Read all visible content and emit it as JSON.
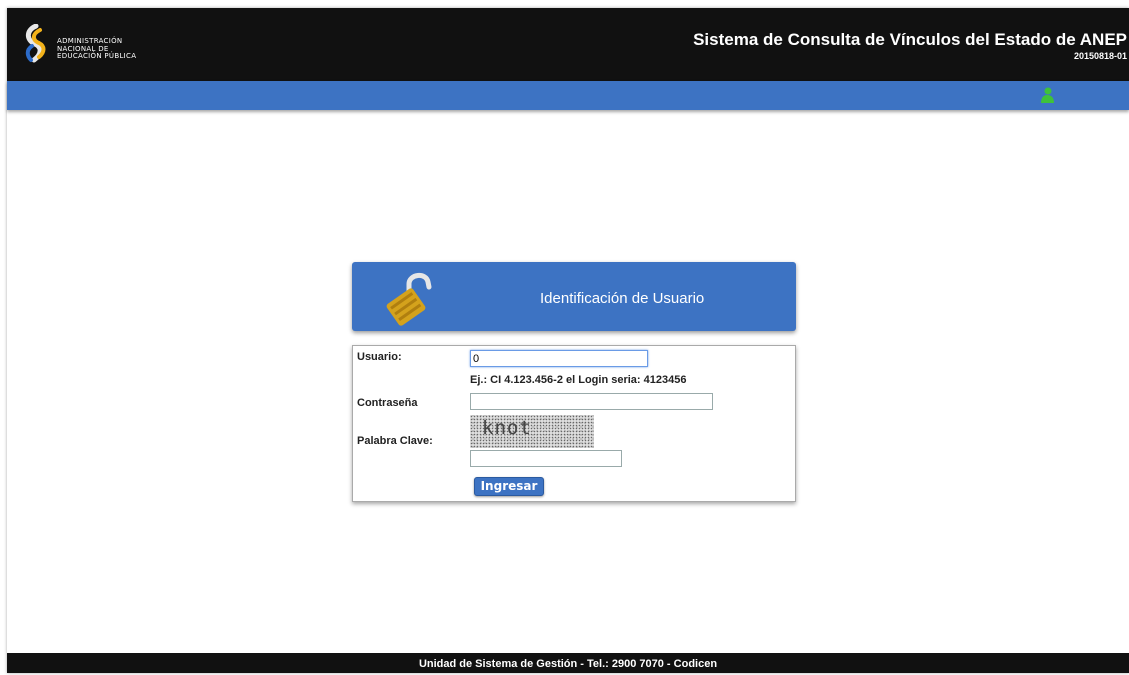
{
  "header": {
    "logo_lines": [
      "ADMINISTRACIÓN",
      "NACIONAL DE",
      "EDUCACIÓN PÚBLICA"
    ],
    "title": "Sistema de Consulta de Vínculos del Estado de ANEP",
    "version": "20150818-01"
  },
  "toolbar": {
    "user_icon": "user-icon"
  },
  "login": {
    "heading": "Identificación de Usuario",
    "usuario_label": "Usuario:",
    "usuario_value": "0",
    "usuario_hint": "Ej.: CI 4.123.456-2 el Login seria: 4123456",
    "contrasena_label": "Contraseña",
    "contrasena_value": "",
    "palabra_label": "Palabra Clave:",
    "captcha_word": "knot",
    "palabra_value": "",
    "submit_label": "Ingresar"
  },
  "footer": {
    "text": "Unidad de Sistema de Gestión - Tel.: 2900 7070 - Codicen"
  },
  "colors": {
    "header_bg": "#111111",
    "accent_blue": "#3d73c3",
    "footer_bg": "#111111"
  }
}
